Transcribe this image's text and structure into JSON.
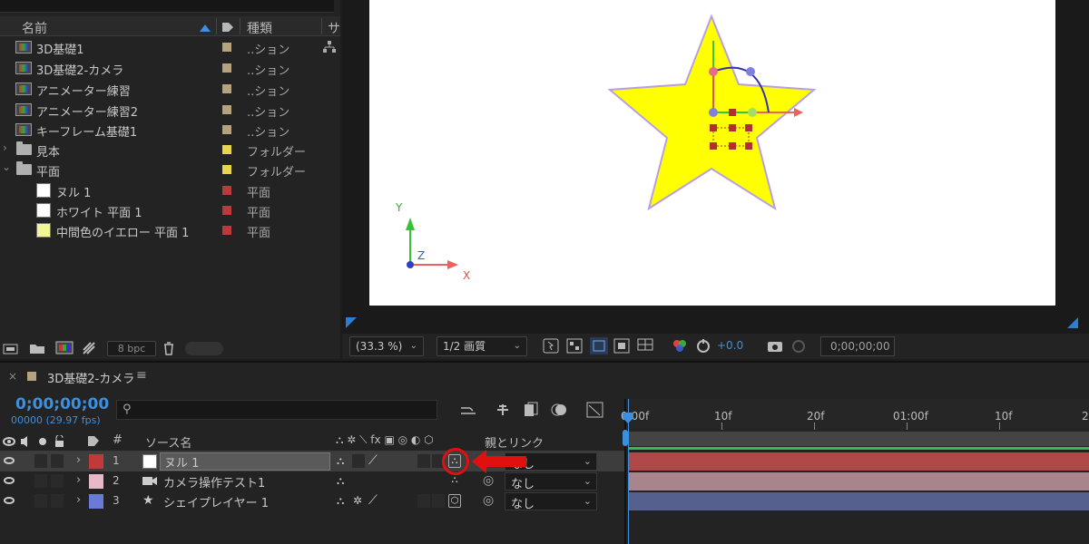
{
  "project": {
    "columns": {
      "name": "名前",
      "type": "種類",
      "extra": "サ"
    },
    "items": [
      {
        "kind": "comp",
        "label": "3D基礎1",
        "type": "..ション",
        "tag": "#b5a27e",
        "indent": 0
      },
      {
        "kind": "comp",
        "label": "3D基礎2-カメラ",
        "type": "..ション",
        "tag": "#b5a27e",
        "indent": 0
      },
      {
        "kind": "comp",
        "label": "アニメーター練習",
        "type": "..ション",
        "tag": "#b5a27e",
        "indent": 0
      },
      {
        "kind": "comp",
        "label": "アニメーター練習2",
        "type": "..ション",
        "tag": "#b5a27e",
        "indent": 0
      },
      {
        "kind": "comp",
        "label": "キーフレーム基礎1",
        "type": "..ション",
        "tag": "#b5a27e",
        "indent": 0
      },
      {
        "kind": "folder",
        "label": "見本",
        "type": "フォルダー",
        "tag": "#e8d44d",
        "indent": 0,
        "expanded": false
      },
      {
        "kind": "folder",
        "label": "平面",
        "type": "フォルダー",
        "tag": "#e8d44d",
        "indent": 0,
        "expanded": true
      },
      {
        "kind": "solid",
        "label": "ヌル 1",
        "type": "平面",
        "tag": "#b83a3a",
        "indent": 1,
        "swatch": "#ffffff"
      },
      {
        "kind": "solid",
        "label": "ホワイト 平面 1",
        "type": "平面",
        "tag": "#b83a3a",
        "indent": 1,
        "swatch": "#ffffff"
      },
      {
        "kind": "solid",
        "label": "中間色のイエロー 平面 1",
        "type": "平面",
        "tag": "#b83a3a",
        "indent": 1,
        "swatch": "#f0f59a"
      }
    ],
    "footer": {
      "bpc": "8 bpc"
    }
  },
  "viewer": {
    "zoom": "(33.3 %)",
    "resolution": "1/2 画質",
    "exposure": "+0.0",
    "timecode": "0;00;00;00",
    "axis": {
      "x": "X",
      "y": "Y",
      "z": "Z"
    }
  },
  "timeline": {
    "comp_name": "3D基礎2-カメラ",
    "timecode": "0;00;00;00",
    "frames": "00000 (29.97 fps)",
    "search_placeholder": "",
    "headers": {
      "source": "ソース名",
      "number": "#",
      "parent": "親とリンク"
    },
    "ruler": [
      "0:00f",
      "10f",
      "20f",
      "01:00f",
      "10f",
      "2"
    ],
    "layers": [
      {
        "num": "1",
        "name": "ヌル 1",
        "color": "#c03a3a",
        "icon": "",
        "parent": "なし",
        "selected": true,
        "bar": "#b04848",
        "switches": "⌖",
        "threed": "⛬"
      },
      {
        "num": "2",
        "name": "カメラ操作テスト1",
        "color": "#e8b8c8",
        "icon": "camera",
        "parent": "なし",
        "selected": false,
        "bar": "#a8848c",
        "switches": "⌖",
        "threed": "⛬"
      },
      {
        "num": "3",
        "name": "シェイプレイヤー 1",
        "color": "#6a7ad8",
        "icon": "star",
        "parent": "なし",
        "selected": false,
        "bar": "#56608e",
        "switches": "⌖",
        "threed": "⬡"
      }
    ]
  },
  "colors": {
    "accent": "#3d8fe0",
    "annotation": "#e01010"
  }
}
